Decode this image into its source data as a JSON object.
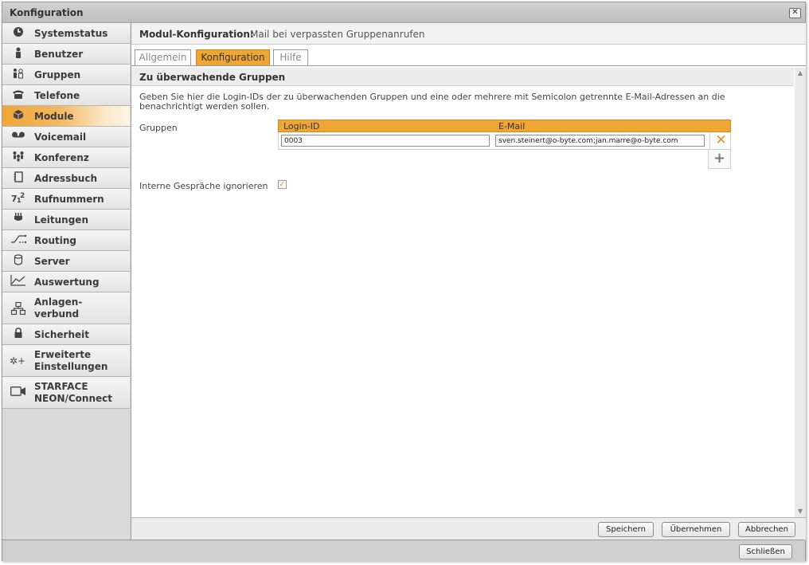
{
  "window": {
    "title": "Konfiguration",
    "close_label": "✕"
  },
  "sidebar": {
    "items": [
      {
        "label": "Systemstatus",
        "icon": "clock-icon"
      },
      {
        "label": "Benutzer",
        "icon": "user-icon"
      },
      {
        "label": "Gruppen",
        "icon": "group-icon"
      },
      {
        "label": "Telefone",
        "icon": "phone-icon"
      },
      {
        "label": "Module",
        "icon": "cube-icon",
        "active": true
      },
      {
        "label": "Voicemail",
        "icon": "voicemail-icon"
      },
      {
        "label": "Konferenz",
        "icon": "conference-icon"
      },
      {
        "label": "Adressbuch",
        "icon": "addressbook-icon"
      },
      {
        "label": "Rufnummern",
        "icon": "numbers-icon"
      },
      {
        "label": "Leitungen",
        "icon": "plug-icon"
      },
      {
        "label": "Routing",
        "icon": "routing-icon"
      },
      {
        "label": "Server",
        "icon": "server-icon"
      },
      {
        "label": "Auswertung",
        "icon": "chart-icon"
      },
      {
        "label": "Anlagen-\nverbund",
        "icon": "network-icon"
      },
      {
        "label": "Sicherheit",
        "icon": "lock-icon"
      },
      {
        "label": "Erweiterte\nEinstellungen",
        "icon": "advanced-settings-icon"
      },
      {
        "label": "STARFACE\nNEON/Connect",
        "icon": "camera-icon"
      }
    ]
  },
  "main": {
    "header_label": "Modul-Konfiguration:",
    "header_value": "Mail bei verpassten Gruppenanrufen",
    "tabs": [
      {
        "label": "Allgemein"
      },
      {
        "label": "Konfiguration",
        "active": true
      },
      {
        "label": "Hilfe"
      }
    ],
    "section_title": "Zu überwachende Gruppen",
    "description": "Geben Sie hier die Login-IDs der zu überwachenden Gruppen und eine oder mehrere mit Semicolon getrennte E-Mail-Adressen an die benachrichtigt werden sollen.",
    "groups_label": "Gruppen",
    "table": {
      "columns": [
        "Login-ID",
        "E-Mail"
      ],
      "rows": [
        {
          "login_id": "0003",
          "email": "sven.steinert@o-byte.com;jan.marre@o-byte.com"
        }
      ]
    },
    "ignore_label": "Interne Gespräche ignorieren",
    "ignore_checked": true,
    "buttons": {
      "save": "Speichern",
      "apply": "Übernehmen",
      "cancel": "Abbrechen"
    }
  },
  "bottom": {
    "close_button": "Schließen"
  },
  "colors": {
    "accent": "#f0a635",
    "remove": "#e8902a"
  }
}
